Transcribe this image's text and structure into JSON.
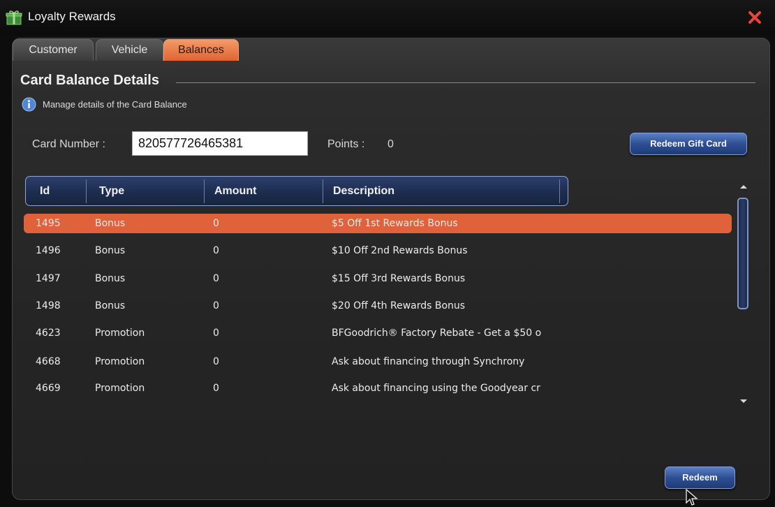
{
  "window": {
    "title": "Loyalty Rewards",
    "icon": "gift-icon",
    "close_icon": "close-icon"
  },
  "tabs": [
    {
      "label": "Customer",
      "active": false
    },
    {
      "label": "Vehicle",
      "active": false
    },
    {
      "label": "Balances",
      "active": true
    }
  ],
  "section": {
    "title": "Card Balance Details",
    "info_text": "Manage details of the Card Balance"
  },
  "card": {
    "label": "Card Number :",
    "value": "820577726465381",
    "points_label": "Points :",
    "points_value": "0"
  },
  "buttons": {
    "redeem_gift_card": "Redeem Gift Card",
    "redeem": "Redeem"
  },
  "table": {
    "columns": [
      "Id",
      "Type",
      "Amount",
      "Description"
    ],
    "selected_index": 0,
    "rows": [
      {
        "id": "1495",
        "type": "Bonus",
        "amount": "0",
        "description": "$5 Off 1st Rewards Bonus"
      },
      {
        "id": "1496",
        "type": "Bonus",
        "amount": "0",
        "description": "$10 Off 2nd Rewards Bonus"
      },
      {
        "id": "1497",
        "type": "Bonus",
        "amount": "0",
        "description": "$15 Off 3rd Rewards Bonus"
      },
      {
        "id": "1498",
        "type": "Bonus",
        "amount": "0",
        "description": "$20 Off 4th Rewards Bonus"
      },
      {
        "id": "4623",
        "type": "Promotion",
        "amount": "0",
        "description": "BFGoodrich® Factory Rebate - Get a $50 o"
      },
      {
        "id": "4668",
        "type": "Promotion",
        "amount": "0",
        "description": "Ask about financing through Synchrony"
      },
      {
        "id": "4669",
        "type": "Promotion",
        "amount": "0",
        "description": "Ask about financing using the Goodyear cr"
      }
    ]
  },
  "colors": {
    "accent_orange": "#e0623a",
    "header_blue": "#1c2b4e",
    "button_blue": "#2f4f94",
    "close_red": "#e8453c"
  }
}
